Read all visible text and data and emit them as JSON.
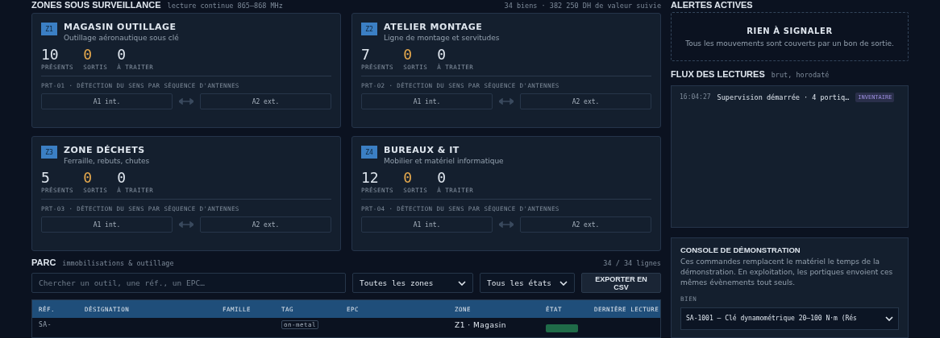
{
  "zones_section": {
    "title": "ZONES SOUS SURVEILLANCE",
    "subtitle": "lecture continue 865–868 MHz",
    "summary": "34 biens · 382 250 DH de valeur suivie"
  },
  "zones": [
    {
      "code": "Z1",
      "name": "MAGASIN OUTILLAGE",
      "description": "Outillage aéronautique sous clé",
      "stats": [
        {
          "kind": "present",
          "value": "10",
          "label": "PRÉSENTS"
        },
        {
          "kind": "out",
          "value": "0",
          "label": "SORTIS"
        },
        {
          "kind": "todo",
          "value": "0",
          "label": "À TRAITER"
        }
      ],
      "portal": "PRT-01 · DÉTECTION DU SENS PAR SÉQUENCE D'ANTENNES",
      "antennas": [
        "A1 int.",
        "A2 ext."
      ]
    },
    {
      "code": "Z2",
      "name": "ATELIER MONTAGE",
      "description": "Ligne de montage et servitudes",
      "stats": [
        {
          "kind": "present",
          "value": "7",
          "label": "PRÉSENTS"
        },
        {
          "kind": "out",
          "value": "0",
          "label": "SORTIS"
        },
        {
          "kind": "todo",
          "value": "0",
          "label": "À TRAITER"
        }
      ],
      "portal": "PRT-02 · DÉTECTION DU SENS PAR SÉQUENCE D'ANTENNES",
      "antennas": [
        "A1 int.",
        "A2 ext."
      ]
    },
    {
      "code": "Z3",
      "name": "ZONE DÉCHETS",
      "description": "Ferraille, rebuts, chutes",
      "stats": [
        {
          "kind": "present",
          "value": "5",
          "label": "PRÉSENTS"
        },
        {
          "kind": "out",
          "value": "0",
          "label": "SORTIS"
        },
        {
          "kind": "todo",
          "value": "0",
          "label": "À TRAITER"
        }
      ],
      "portal": "PRT-03 · DÉTECTION DU SENS PAR SÉQUENCE D'ANTENNES",
      "antennas": [
        "A1 int.",
        "A2 ext."
      ]
    },
    {
      "code": "Z4",
      "name": "BUREAUX & IT",
      "description": "Mobilier et matériel informatique",
      "stats": [
        {
          "kind": "present",
          "value": "12",
          "label": "PRÉSENTS"
        },
        {
          "kind": "out",
          "value": "0",
          "label": "SORTIS"
        },
        {
          "kind": "todo",
          "value": "0",
          "label": "À TRAITER"
        }
      ],
      "portal": "PRT-04 · DÉTECTION DU SENS PAR SÉQUENCE D'ANTENNES",
      "antennas": [
        "A1 int.",
        "A2 ext."
      ]
    }
  ],
  "parc": {
    "title": "PARC",
    "subtitle": "immobilisations & outillage",
    "count": "34 / 34 lignes",
    "search": {
      "placeholder": "Chercher un outil, une réf., un EPC…"
    },
    "zone_filter": "Toutes les zones",
    "state_filter": "Tous les états",
    "export_button": "EXPORTER EN CSV"
  },
  "table": {
    "columns": [
      "RÉF.",
      "DÉSIGNATION",
      "FAMILLE",
      "TAG",
      "EPC",
      "ZONE",
      "ÉTAT",
      "DERNIÈRE LECTURE"
    ],
    "rows": [
      {
        "ref": "SA-",
        "tag": "on-metal",
        "zone": "Z1 · Magasin",
        "color": "#1f6b48"
      }
    ]
  },
  "alerts": {
    "title": "ALERTES ACTIVES",
    "heading": "RIEN À SIGNALER",
    "message": "Tous les mouvements sont couverts par un bon de sortie."
  },
  "feed": {
    "title": "FLUX DES LECTURES",
    "subtitle": "brut, horodaté",
    "entries": [
      {
        "time": "16:04:27",
        "text": "Supervision démarrée · 4 portiq…",
        "tag": "INVENTAIRE"
      }
    ]
  },
  "console": {
    "title": "CONSOLE DE DÉMONSTRATION",
    "description": "Ces commandes remplacent le matériel le temps de la démonstration. En exploitation, les portiques envoient ces mêmes évènements tout seuls.",
    "asset_label": "BIEN",
    "asset_value": "SA-1001 — Clé dynamométrique 20–100 N·m (Rés"
  }
}
